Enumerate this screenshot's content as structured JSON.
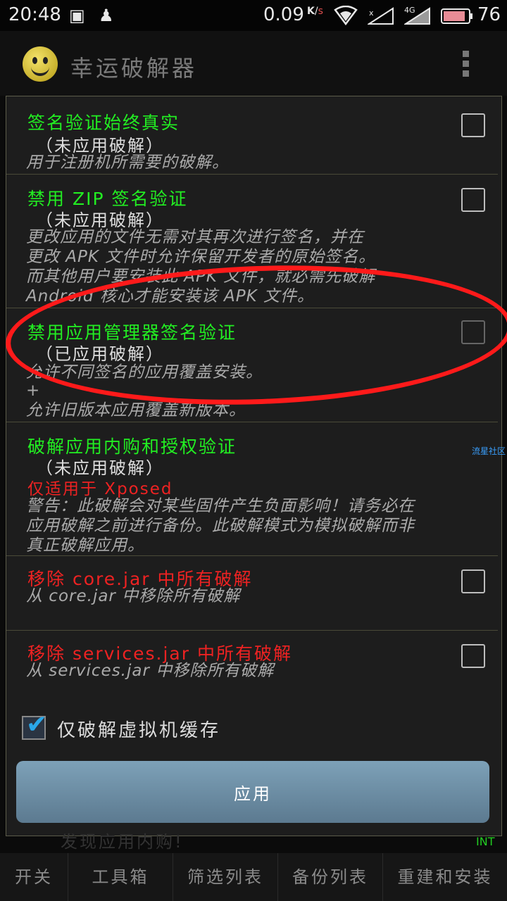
{
  "status_bar": {
    "time": "20:48",
    "net_speed": "0.09",
    "net_unit_top": "K",
    "net_unit_bottom": "s",
    "signal_label": "4G",
    "battery": "76"
  },
  "app_bar": {
    "title": "幸运破解器"
  },
  "patches": [
    {
      "title": "签名验证始终真实",
      "status": "（未应用破解）",
      "desc": [
        "用于注册机所需要的破解。"
      ],
      "checked": false
    },
    {
      "title": "禁用 ZIP 签名验证",
      "status": "（未应用破解）",
      "desc": [
        "更改应用的文件无需对其再次进行签名，并在",
        "更改 APK 文件时允许保留开发者的原始签名。",
        "而其他用户要安装此 APK 文件，就必需先破解",
        "Android 核心才能安装该 APK 文件。"
      ],
      "checked": false
    },
    {
      "title": "禁用应用管理器签名验证",
      "status": "（已应用破解）",
      "desc": [
        "允许不同签名的应用覆盖安装。",
        "+",
        "允许旧版本应用覆盖新版本。"
      ],
      "checked": false
    },
    {
      "title": "破解应用内购和授权验证",
      "status": "（未应用破解）",
      "note": "仅适用于 Xposed",
      "desc": [
        "警告：此破解会对某些固件产生负面影响！请务必在",
        "应用破解之前进行备份。此破解模式为模拟破解而非",
        "真正破解应用。"
      ]
    },
    {
      "title": "移除 core.jar 中所有破解",
      "desc": [
        "从 core.jar 中移除所有破解"
      ],
      "checked": false
    },
    {
      "title": "移除 services.jar 中所有破解",
      "desc": [
        "从 services.jar 中移除所有破解"
      ],
      "checked": false
    }
  ],
  "vm_cache": {
    "label": "仅破解虚拟机缓存",
    "checked": true
  },
  "apply_button": "应用",
  "side_label": "流星社区",
  "bottom_hint": "发现应用内购!",
  "int_label": "INT",
  "bottom_nav": [
    "开关",
    "工具箱",
    "筛选列表",
    "备份列表",
    "重建和安装"
  ],
  "colors": {
    "title_green": "#22ee22",
    "title_red": "#ee2222",
    "annotation": "#ff1a1a",
    "button": "#6d8ea4"
  }
}
